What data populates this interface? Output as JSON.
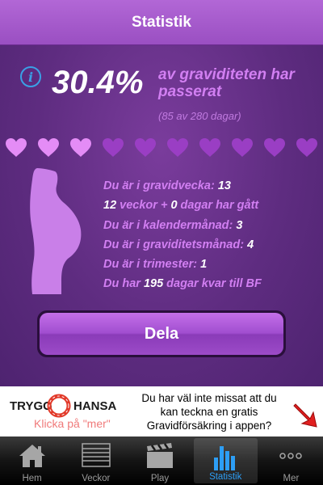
{
  "navbar": {
    "title": "Statistik"
  },
  "summary": {
    "percent": "30.4%",
    "percent_text": "av graviditeten har passerat",
    "days_text": "(85 av 280 dagar)",
    "hearts_total": 10,
    "hearts_filled": 3
  },
  "stats": [
    {
      "label": "Du är i gravidvecka: ",
      "value": "13"
    },
    {
      "value": "12",
      "label": " veckor +  ",
      "value2": "0",
      "label2": " dagar har gått"
    },
    {
      "label": "Du är i kalendermånad: ",
      "value": "3"
    },
    {
      "label": "Du är i graviditetsmånad: ",
      "value": "4"
    },
    {
      "label": "Du är i trimester: ",
      "value": "1"
    },
    {
      "label": "Du har ",
      "value": "195",
      "label2": " dagar kvar till BF"
    }
  ],
  "share_button": {
    "label": "Dela"
  },
  "ad": {
    "brand_left": "TRYGG",
    "brand_right": "HANSA",
    "click_text": "Klicka på \"mer\"",
    "copy": "Du har väl inte missat att du kan teckna en gratis Gravidförsäkring i appen?"
  },
  "tabbar": {
    "tabs": [
      {
        "label": "Hem",
        "icon": "house-icon"
      },
      {
        "label": "Veckor",
        "icon": "list-icon"
      },
      {
        "label": "Play",
        "icon": "clapperboard-icon"
      },
      {
        "label": "Statistik",
        "icon": "bar-chart-icon"
      },
      {
        "label": "Mer",
        "icon": "more-dots-icon"
      }
    ],
    "active": "Statistik"
  },
  "colors": {
    "accent_purple": "#d27ff2",
    "active_blue": "#2d9ef5",
    "heart_filled": "#e48cf6",
    "heart_empty": "#9a3ec4"
  }
}
